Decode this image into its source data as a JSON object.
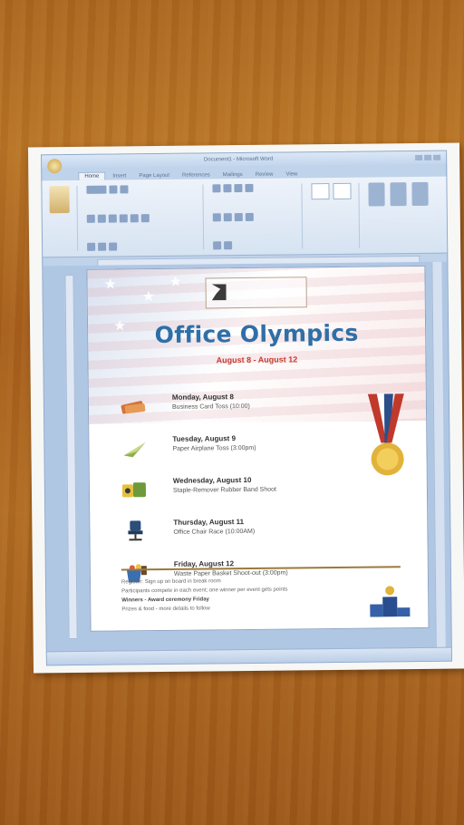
{
  "window": {
    "title": "Document1 - Microsoft Word"
  },
  "ribbon_tabs": [
    "Home",
    "Insert",
    "Page Layout",
    "References",
    "Mailings",
    "Review",
    "View"
  ],
  "flyer": {
    "title": "Office Olympics",
    "dates": "August 8 - August 12",
    "events": [
      {
        "day": "Monday, August 8",
        "name": "Business Card Toss (10:00)",
        "icon": "card-icon"
      },
      {
        "day": "Tuesday, August 9",
        "name": "Paper Airplane Toss (3:00pm)",
        "icon": "paper-airplane-icon"
      },
      {
        "day": "Wednesday, August 10",
        "name": "Staple-Remover Rubber Band Shoot",
        "icon": "staple-remover-icon"
      },
      {
        "day": "Thursday, August 11",
        "name": "Office Chair Race (10:00AM)",
        "icon": "office-chair-icon"
      },
      {
        "day": "Friday, August 12",
        "name": "Waste Paper Basket Shoot-out (3:00pm)",
        "icon": "waste-basket-icon"
      }
    ],
    "footer_line1": "Register: Sign up on board in break room",
    "footer_line2": "Participants compete in each event; one winner per event gets points",
    "footer_line3": "Winners - Award ceremony Friday",
    "footer_line4": "Prizes & food - more details to follow"
  },
  "colors": {
    "title": "#2f6fa7",
    "dates": "#c53a2e",
    "wood": "#a9661f"
  }
}
